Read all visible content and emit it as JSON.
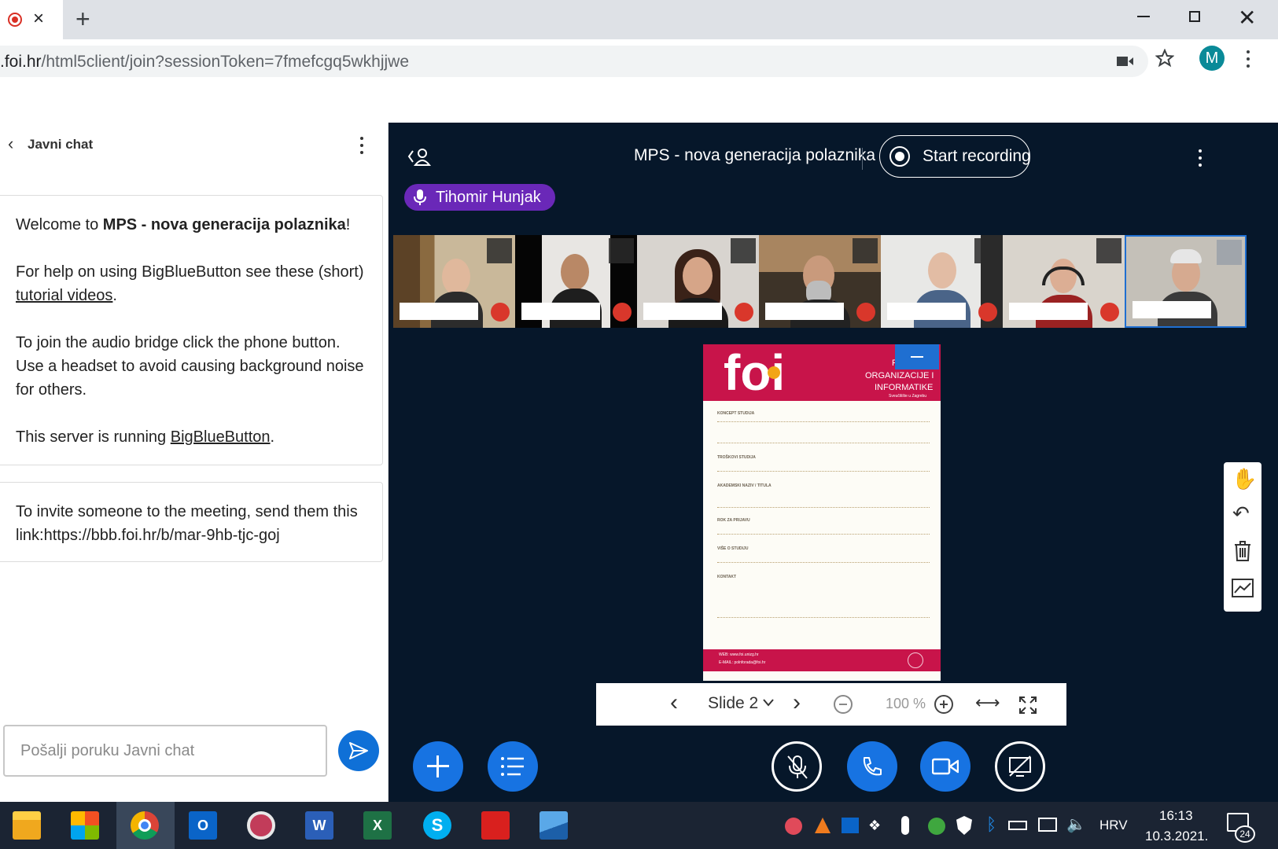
{
  "browser": {
    "url_host_tail": ".foi.hr",
    "url_path": "/html5client/join?sessionToken=7fmefcgq5wkhjjwe",
    "profile_initial": "M",
    "accent": "#0a8a98"
  },
  "chat": {
    "title": "Javni chat",
    "welcome": {
      "prefix": "Welcome to ",
      "meeting_name": "MPS - nova generacija polaznika",
      "suffix": "!",
      "help_prefix": "For help on using BigBlueButton see these (short) ",
      "help_link": "tutorial videos",
      "help_suffix": ".",
      "audio_text": "To join the audio bridge click the phone button. Use a headset to avoid causing background noise for others.",
      "server_prefix": "This server is running ",
      "server_link": "BigBlueButton",
      "server_suffix": "."
    },
    "invite_text": "To invite someone to the meeting, send them this link:https://bbb.foi.hr/b/mar-9hb-tjc-goj",
    "input_placeholder": "Pošalji poruku Javni chat"
  },
  "meeting": {
    "title": "MPS - nova generacija polaznika",
    "record_label": "Start recording",
    "talker_name": "Tihomir Hunjak"
  },
  "slide": {
    "logo": "foi",
    "header_lines": [
      "F",
      "ORGANIZACIJE I",
      "INFORMATIKE"
    ],
    "header_subline": "Sveučilište u Zagrebu",
    "sections": [
      "KONCEPT STUDIJA",
      "TROŠKOVI STUDIJA",
      "AKADEMSKI NAZIV / TITULA",
      "ROK ZA PRIJAVU",
      "VIŠE O STUDIJU",
      "KONTAKT"
    ],
    "footer_line1": "WEB: www.foi.unizg.hr",
    "footer_line2": "E-MAIL: polnforada@foi.hr"
  },
  "toolbar": {
    "slide_label": "Slide 2",
    "zoom_label": "100 %"
  },
  "taskbar": {
    "language": "HRV",
    "time": "16:13",
    "date": "10.3.2021.",
    "notifications": "24"
  }
}
